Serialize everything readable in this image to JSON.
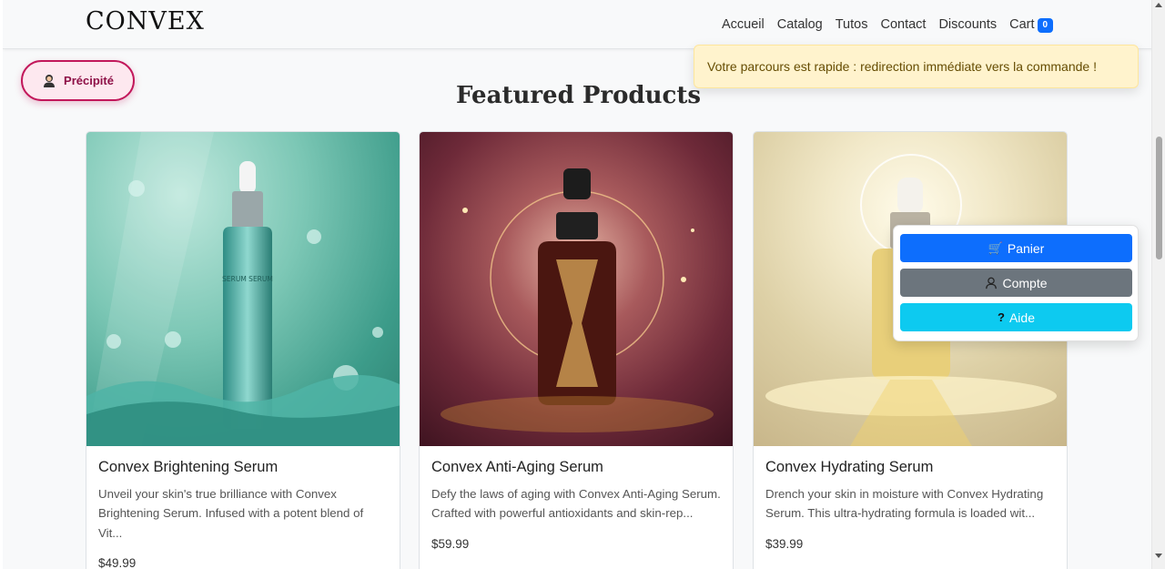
{
  "brand": "CONVEX",
  "nav": {
    "items": [
      "Accueil",
      "Catalog",
      "Tutos",
      "Contact",
      "Discounts"
    ],
    "cart_label": "Cart",
    "cart_count": "0"
  },
  "toast": "Votre parcours est rapide : redirection immédiate vers la commande !",
  "persona_pill": "Précipité",
  "section_title": "Featured Products",
  "products": [
    {
      "name": "Convex Brightening Serum",
      "description": "Unveil your skin's true brilliance with Convex Brightening Serum. Infused with a potent blend of Vit...",
      "price": "$49.99",
      "bottle_label": "SERUM SERUM"
    },
    {
      "name": "Convex Anti-Aging Serum",
      "description": "Defy the laws of aging with Convex Anti-Aging Serum. Crafted with powerful antioxidants and skin-rep...",
      "price": "$59.99"
    },
    {
      "name": "Convex Hydrating Serum",
      "description": "Drench your skin in moisture with Convex Hydrating Serum. This ultra-hydrating formula is loaded wit...",
      "price": "$39.99"
    }
  ],
  "menu": {
    "cart": "Panier",
    "account": "Compte",
    "help": "Aide"
  },
  "colors": {
    "primary": "#0d6efd",
    "secondary": "#6c757d",
    "info": "#0dcaf0",
    "warning_bg": "#fff3cd",
    "pill_border": "#c2185b"
  }
}
